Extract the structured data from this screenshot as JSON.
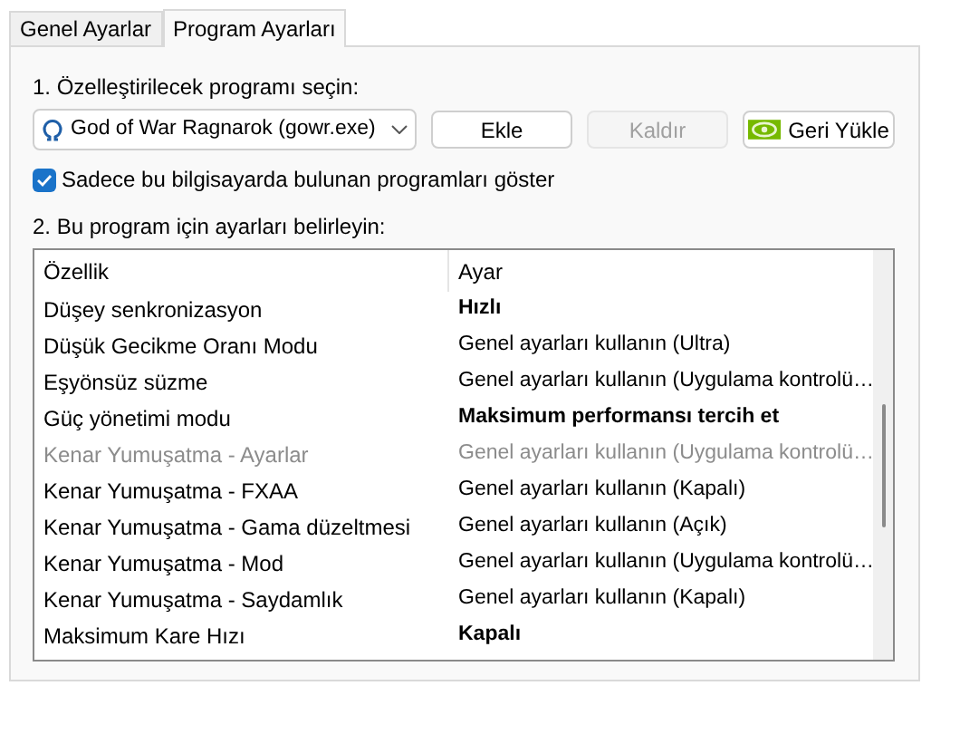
{
  "tabs": [
    {
      "label": "Genel Ayarlar",
      "selected": false
    },
    {
      "label": "Program Ayarları",
      "selected": true
    }
  ],
  "program_label": "1. Özelleştirilecek programı seçin:",
  "program_select": {
    "value": "God of War Ragnarok (gowr.exe)"
  },
  "buttons": [
    {
      "kind": "plain",
      "label": "Ekle",
      "disabled": false
    },
    {
      "kind": "plain",
      "label": "Kaldır",
      "disabled": true
    },
    {
      "kind": "logo",
      "label": "Geri Yükle",
      "disabled": false
    }
  ],
  "show_local": {
    "label": "Sadece bu bilgisayarda bulunan programları göster",
    "checked": true
  },
  "settings_label": "2. Bu program için ayarları belirleyin:",
  "table": {
    "columns": [
      "Özellik",
      "Ayar"
    ],
    "rows": [
      {
        "feature": "Düşey senkronizasyon",
        "setting": "Hızlı",
        "customized": true,
        "disabled": false
      },
      {
        "feature": "Düşük Gecikme Oranı Modu",
        "setting": "Genel ayarları kullanın (Ultra)",
        "customized": false,
        "disabled": false
      },
      {
        "feature": "Eşyönsüz süzme",
        "setting": "Genel ayarları kullanın (Uygulama kontrolü…",
        "customized": false,
        "disabled": false
      },
      {
        "feature": "Güç yönetimi modu",
        "setting": "Maksimum performansı tercih et",
        "customized": true,
        "disabled": false
      },
      {
        "feature": "Kenar Yumuşatma - Ayarlar",
        "setting": "Genel ayarları kullanın (Uygulama kontrolü…",
        "customized": false,
        "disabled": true
      },
      {
        "feature": "Kenar Yumuşatma - FXAA",
        "setting": "Genel ayarları kullanın (Kapalı)",
        "customized": false,
        "disabled": false
      },
      {
        "feature": "Kenar Yumuşatma - Gama düzeltmesi",
        "setting": "Genel ayarları kullanın (Açık)",
        "customized": false,
        "disabled": false
      },
      {
        "feature": "Kenar Yumuşatma - Mod",
        "setting": "Genel ayarları kullanın (Uygulama kontrolü…",
        "customized": false,
        "disabled": false
      },
      {
        "feature": "Kenar Yumuşatma - Saydamlık",
        "setting": "Genel ayarları kullanın (Kapalı)",
        "customized": false,
        "disabled": false
      },
      {
        "feature": "Maksimum Kare Hızı",
        "setting": "Kapalı",
        "customized": true,
        "disabled": false
      }
    ]
  }
}
